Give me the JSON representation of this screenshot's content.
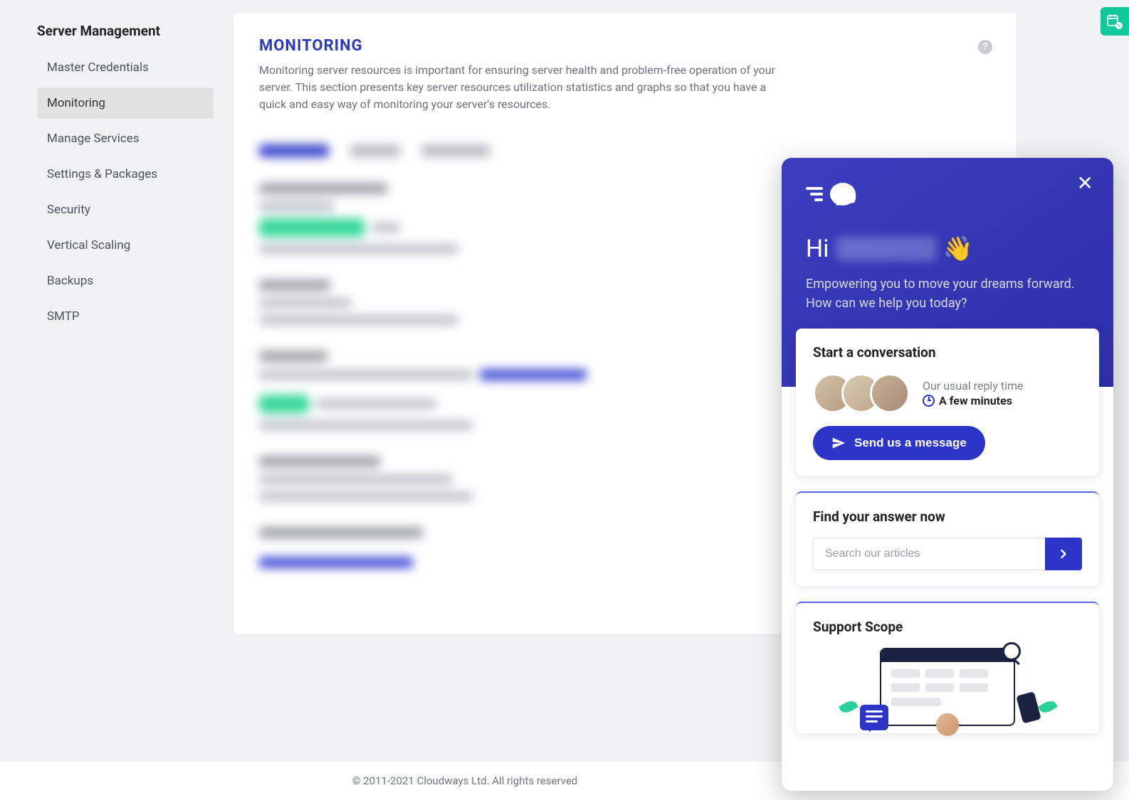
{
  "sidebar": {
    "title": "Server Management",
    "items": [
      {
        "label": "Master Credentials"
      },
      {
        "label": "Monitoring"
      },
      {
        "label": "Manage Services"
      },
      {
        "label": "Settings & Packages"
      },
      {
        "label": "Security"
      },
      {
        "label": "Vertical Scaling"
      },
      {
        "label": "Backups"
      },
      {
        "label": "SMTP"
      }
    ]
  },
  "main": {
    "title": "MONITORING",
    "description": "Monitoring server resources is important for ensuring server health and problem-free operation of your server. This section presents key server resources utilization statistics and graphs so that you have a quick and easy way of monitoring your server's resources."
  },
  "footer": {
    "copyright": "© 2011-2021 Cloudways Ltd. All rights reserved"
  },
  "chat": {
    "greeting_prefix": "Hi",
    "wave": "👋",
    "subtitle": "Empowering you to move your dreams forward. How can we help you today?",
    "conversation": {
      "title": "Start a conversation",
      "reply_label": "Our usual reply time",
      "reply_time": "A few minutes",
      "send_button": "Send us a message"
    },
    "search": {
      "title": "Find your answer now",
      "placeholder": "Search our articles"
    },
    "scope": {
      "title": "Support Scope"
    }
  }
}
